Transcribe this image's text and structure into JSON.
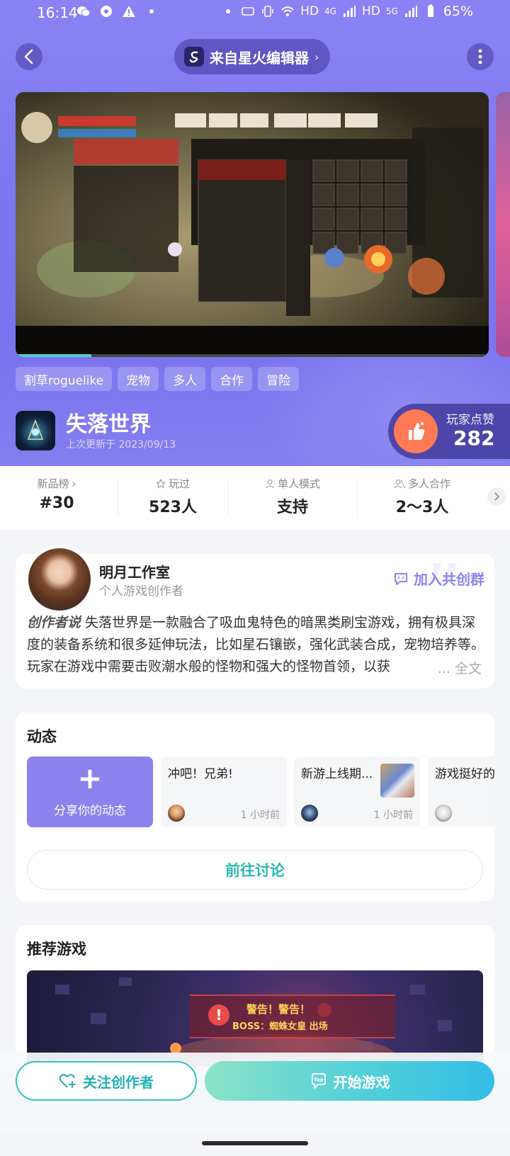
{
  "status_bar": {
    "time": "16:14",
    "network_hd1": "HD",
    "network_4g": "4G",
    "network_hd2": "HD",
    "network_5g": "5G",
    "battery": "65%"
  },
  "header": {
    "source_label": "来自星火编辑器"
  },
  "media": {
    "progress_fraction": 0.16
  },
  "tags": [
    "割草roguelike",
    "宠物",
    "多人",
    "合作",
    "冒险"
  ],
  "game": {
    "title": "失落世界",
    "updated": "上次更新于 2023/09/13"
  },
  "likes": {
    "label": "玩家点赞",
    "count": "282"
  },
  "stats": [
    {
      "key": "新品榜",
      "value": "#30"
    },
    {
      "key": "玩过",
      "value": "523人"
    },
    {
      "key": "单人模式",
      "value": "支持"
    },
    {
      "key": "多人合作",
      "value": "2～3人"
    }
  ],
  "creator": {
    "name": "明月工作室",
    "role": "个人游戏创作者",
    "join_label": "加入共创群",
    "badge": "创作者说",
    "description": "失落世界是一款融合了吸血鬼特色的暗黑类刷宝游戏，拥有极具深度的装备系统和很多延伸玩法，比如星石镶嵌，强化武装合成，宠物培养等。玩家在游戏中需要击败潮水般的怪物和强大的怪物首领，以获",
    "more_label": "... 全文"
  },
  "posts_section": {
    "title": "动态",
    "share_label": "分享你的动态",
    "items": [
      {
        "text": "冲吧！兄弟!",
        "time": "1 小时前"
      },
      {
        "text": "新游上线期...",
        "time": "1 小时前"
      },
      {
        "text": "游戏挺好的...",
        "time": ""
      }
    ],
    "discussion_label": "前往讨论"
  },
  "recommend": {
    "title": "推荐游戏",
    "warning_line1": "警告！警告！",
    "warning_line2": "BOSS：蜘蛛女皇 出场"
  },
  "bottom": {
    "follow_label": "关注创作者",
    "play_label": "开始游戏"
  },
  "colors": {
    "hero": "#7f77f0",
    "accent_teal": "#32c0bc",
    "like_orange": "#ff7a55",
    "join_purple": "#8b84ee"
  }
}
